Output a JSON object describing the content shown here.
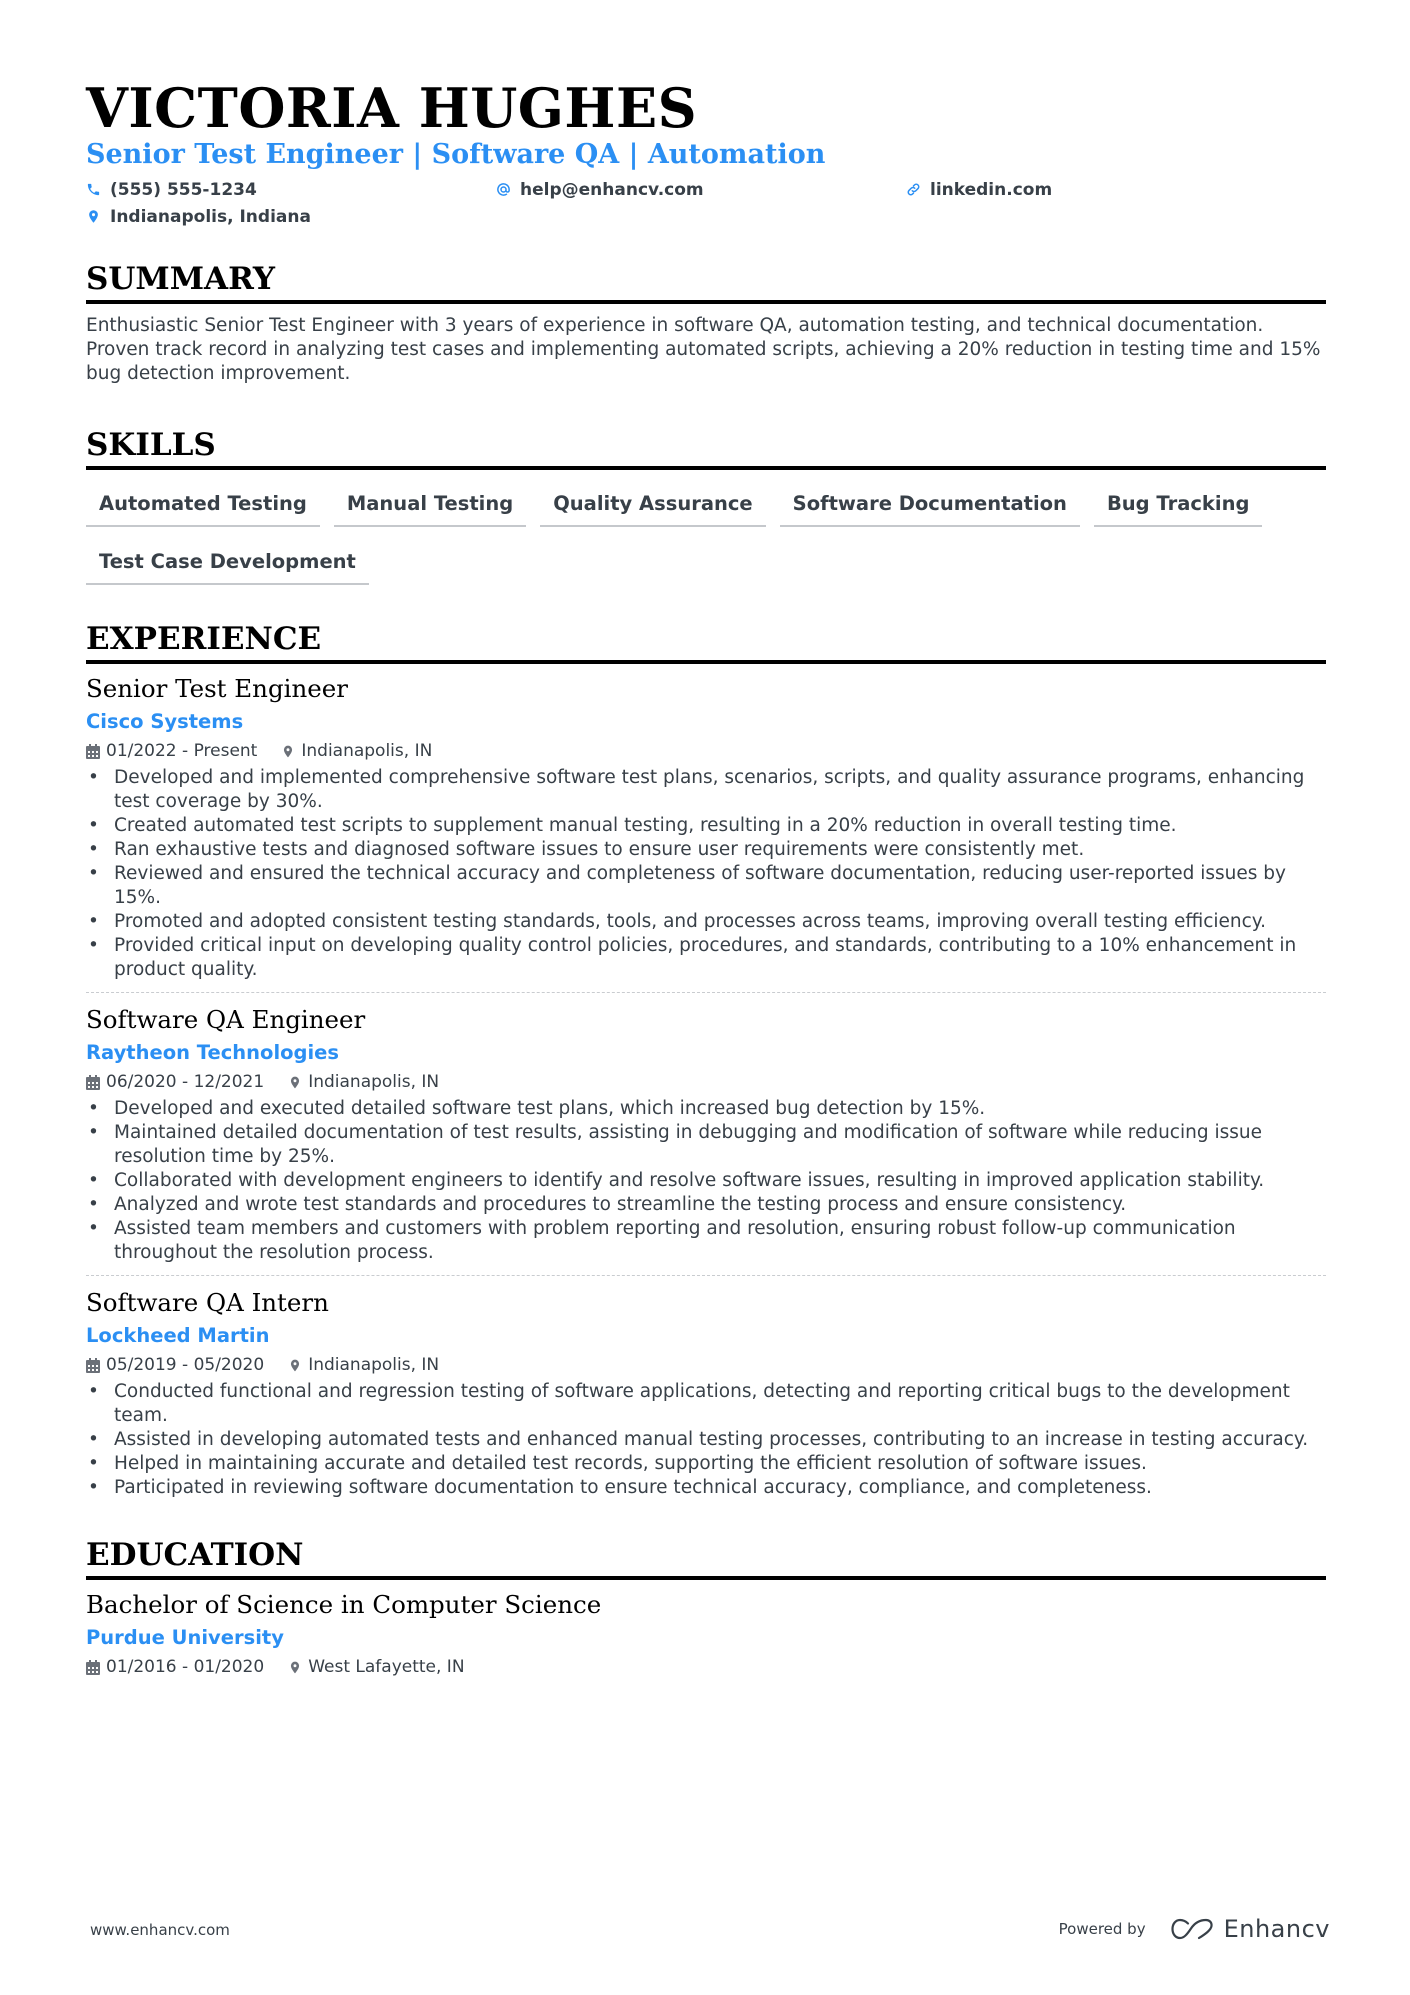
{
  "header": {
    "name": "VICTORIA HUGHES",
    "title": "Senior Test Engineer | Software QA | Automation",
    "contacts": [
      {
        "icon": "phone-icon",
        "text": "(555) 555-1234"
      },
      {
        "icon": "at-icon",
        "text": "help@enhancv.com"
      },
      {
        "icon": "link-icon",
        "text": "linkedin.com"
      },
      {
        "icon": "location-pin-icon",
        "text": "Indianapolis, Indiana"
      }
    ]
  },
  "summary": {
    "heading": "SUMMARY",
    "text": "Enthusiastic Senior Test Engineer with 3 years of experience in software QA, automation testing, and technical documentation. Proven track record in analyzing test cases and implementing automated scripts, achieving a 20% reduction in testing time and 15% bug detection improvement."
  },
  "skills": {
    "heading": "SKILLS",
    "items": [
      "Automated Testing",
      "Manual Testing",
      "Quality Assurance",
      "Software Documentation",
      "Bug Tracking",
      "Test Case Development"
    ]
  },
  "experience": {
    "heading": "EXPERIENCE",
    "jobs": [
      {
        "title": "Senior Test Engineer",
        "company": "Cisco Systems",
        "dates": "01/2022 - Present",
        "location": "Indianapolis, IN",
        "bullets": [
          "Developed and implemented comprehensive software test plans, scenarios, scripts, and quality assurance programs, enhancing test coverage by 30%.",
          "Created automated test scripts to supplement manual testing, resulting in a 20% reduction in overall testing time.",
          "Ran exhaustive tests and diagnosed software issues to ensure user requirements were consistently met.",
          "Reviewed and ensured the technical accuracy and completeness of software documentation, reducing user-reported issues by 15%.",
          "Promoted and adopted consistent testing standards, tools, and processes across teams, improving overall testing efficiency.",
          "Provided critical input on developing quality control policies, procedures, and standards, contributing to a 10% enhancement in product quality."
        ]
      },
      {
        "title": "Software QA Engineer",
        "company": "Raytheon Technologies",
        "dates": "06/2020 - 12/2021",
        "location": "Indianapolis, IN",
        "bullets": [
          "Developed and executed detailed software test plans, which increased bug detection by 15%.",
          "Maintained detailed documentation of test results, assisting in debugging and modification of software while reducing issue resolution time by 25%.",
          "Collaborated with development engineers to identify and resolve software issues, resulting in improved application stability.",
          "Analyzed and wrote test standards and procedures to streamline the testing process and ensure consistency.",
          "Assisted team members and customers with problem reporting and resolution, ensuring robust follow-up communication throughout the resolution process."
        ]
      },
      {
        "title": "Software QA Intern",
        "company": "Lockheed Martin",
        "dates": "05/2019 - 05/2020",
        "location": "Indianapolis, IN",
        "bullets": [
          "Conducted functional and regression testing of software applications, detecting and reporting critical bugs to the development team.",
          "Assisted in developing automated tests and enhanced manual testing processes, contributing to an increase in testing accuracy.",
          "Helped in maintaining accurate and detailed test records, supporting the efficient resolution of software issues.",
          "Participated in reviewing software documentation to ensure technical accuracy, compliance, and completeness."
        ]
      }
    ]
  },
  "education": {
    "heading": "EDUCATION",
    "degree": "Bachelor of Science in Computer Science",
    "school": "Purdue University",
    "dates": "01/2016 - 01/2020",
    "location": "West Lafayette, IN"
  },
  "footer": {
    "website": "www.enhancv.com",
    "powered_by": "Powered by",
    "brand": "Enhancv"
  },
  "colors": {
    "accent": "#2b8ff3",
    "text": "#384048",
    "heading": "#000000"
  }
}
